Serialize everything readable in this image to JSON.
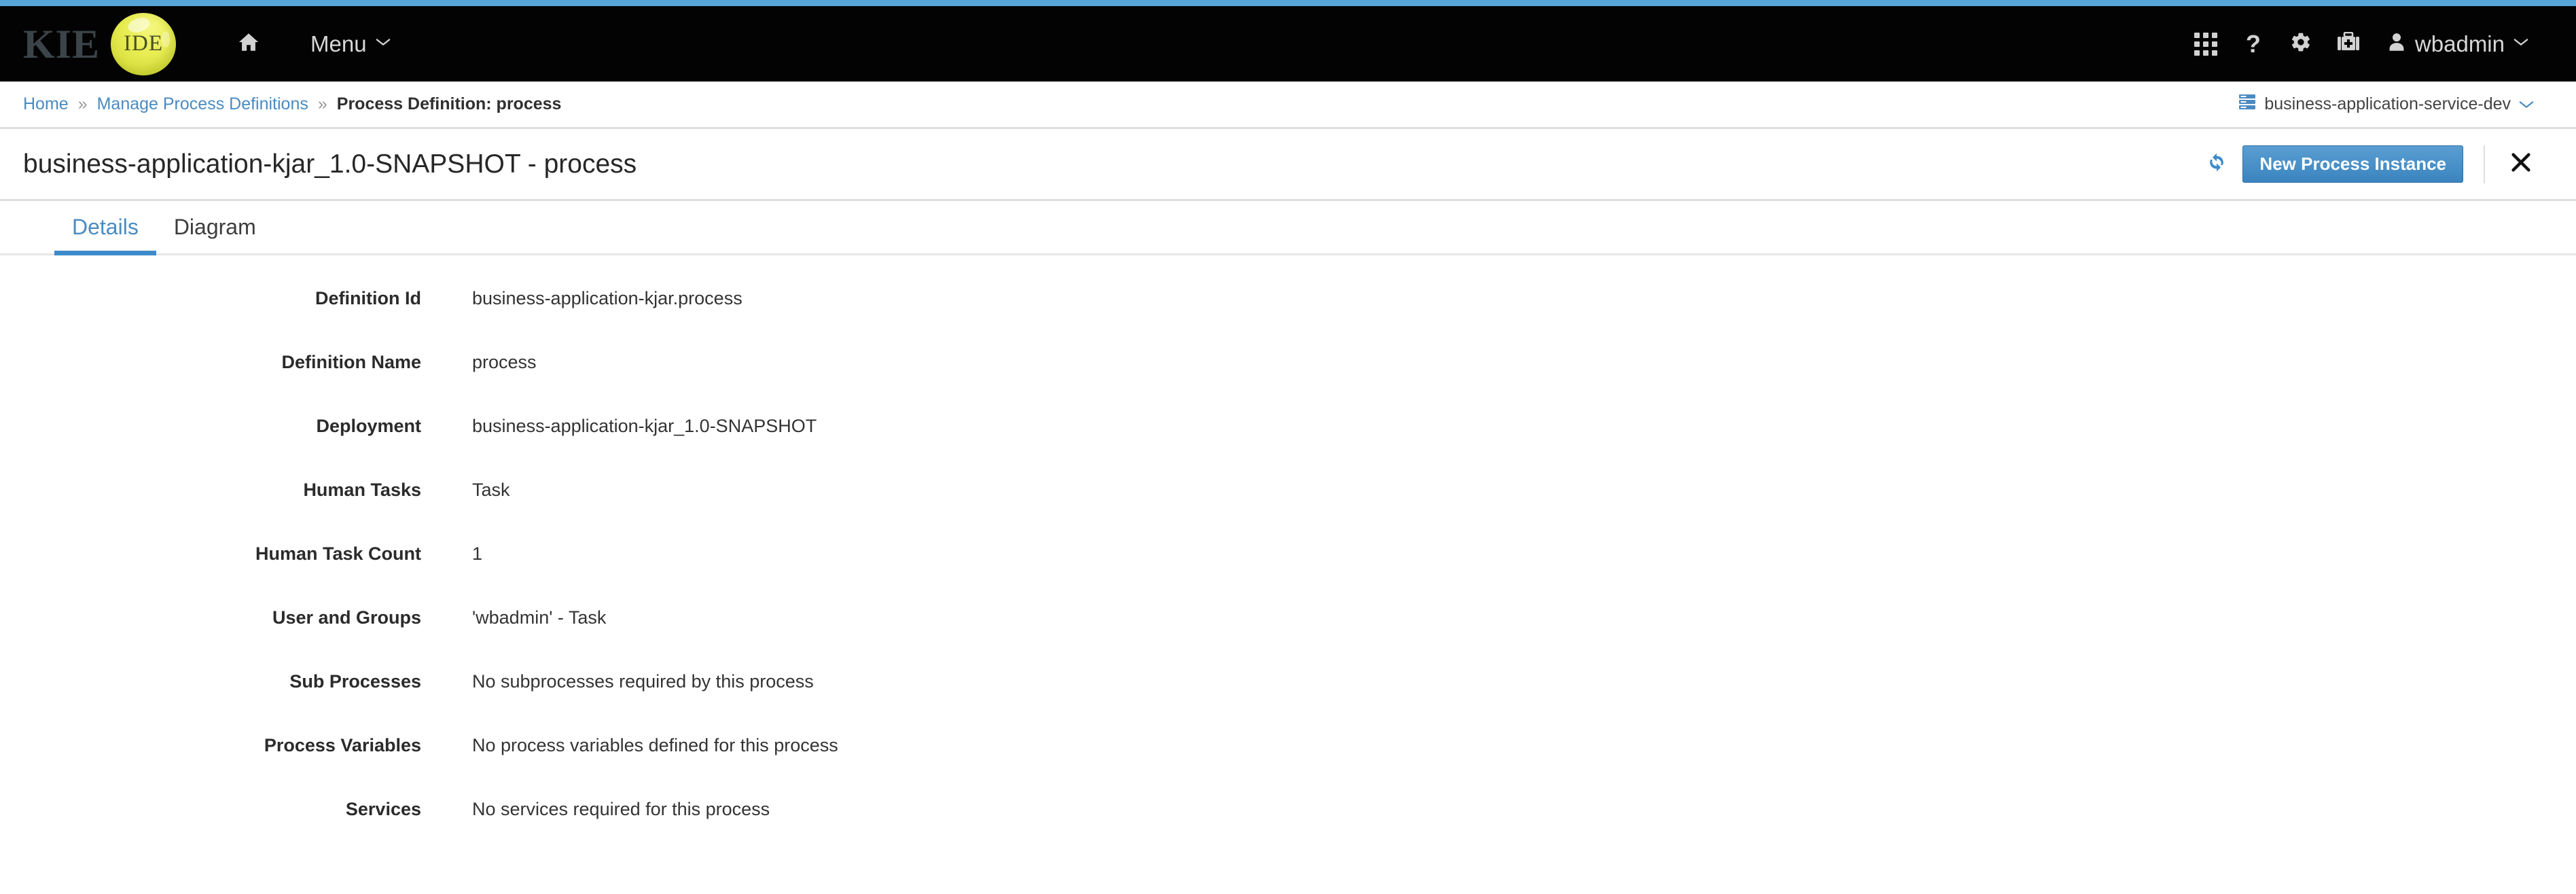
{
  "theme": {
    "accent_strip": "#57a5d6",
    "masthead_bg": "#030303",
    "link_blue": "#4a8bc2",
    "button_blue": "#3b84bf",
    "brand_yellow": "#e9ee55"
  },
  "masthead": {
    "brand_primary": "KIE",
    "brand_badge": "IDE",
    "home_icon": "home-icon",
    "menu_label": "Menu",
    "menu_chevron": "chevron-down-icon",
    "right_icons": [
      {
        "name": "apps-grid-icon",
        "glyph": "grid"
      },
      {
        "name": "help-icon",
        "glyph": "?"
      },
      {
        "name": "gear-icon",
        "glyph": "gear"
      },
      {
        "name": "medkit-icon",
        "glyph": "medkit"
      }
    ],
    "user": {
      "avatar_icon": "user-icon",
      "name": "wbadmin",
      "chevron": "chevron-down-icon"
    }
  },
  "breadcrumb": {
    "items": [
      {
        "label": "Home",
        "current": false
      },
      {
        "label": "Manage Process Definitions",
        "current": false
      },
      {
        "label": "Process Definition: process",
        "current": true
      }
    ],
    "separator": "»"
  },
  "server_selector": {
    "icon": "server-icon",
    "label": "business-application-service-dev",
    "chevron": "chevron-down-icon"
  },
  "title_bar": {
    "title": "business-application-kjar_1.0-SNAPSHOT - process",
    "refresh_icon": "refresh-icon",
    "new_instance_label": "New Process Instance",
    "close_icon": "close-icon"
  },
  "tabs": [
    {
      "label": "Details",
      "active": true
    },
    {
      "label": "Diagram",
      "active": false
    }
  ],
  "details": {
    "fields": [
      {
        "label": "Definition Id",
        "value": "business-application-kjar.process"
      },
      {
        "label": "Definition Name",
        "value": "process"
      },
      {
        "label": "Deployment",
        "value": "business-application-kjar_1.0-SNAPSHOT"
      },
      {
        "label": "Human Tasks",
        "value": "Task"
      },
      {
        "label": "Human Task Count",
        "value": "1"
      },
      {
        "label": "User and Groups",
        "value": "'wbadmin' - Task"
      },
      {
        "label": "Sub Processes",
        "value": "No subprocesses required by this process"
      },
      {
        "label": "Process Variables",
        "value": "No process variables defined for this process"
      },
      {
        "label": "Services",
        "value": "No services required for this process"
      }
    ]
  }
}
